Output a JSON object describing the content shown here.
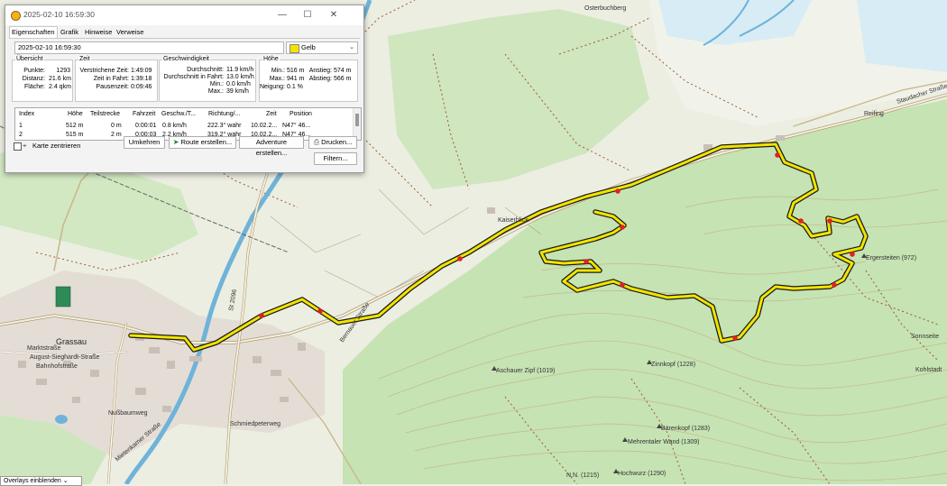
{
  "window": {
    "title": "2025-02-10 16:59:30",
    "tabs": [
      "Eigenschaften",
      "Grafik",
      "Hinweise",
      "Verweise"
    ],
    "name_value": "2025-02-10 16:59:30",
    "color_value": "Gelb",
    "colors": {
      "track": "#f2e400",
      "track_outline": "#222222"
    },
    "groups": {
      "overview": {
        "title": "Übersicht",
        "rows": [
          {
            "k": "Punkte:",
            "v": "1293"
          },
          {
            "k": "Distanz:",
            "v": "21.6 km"
          },
          {
            "k": "Fläche:",
            "v": "2.4 qkm"
          }
        ]
      },
      "time": {
        "title": "Zeit",
        "rows": [
          {
            "k": "Verstrichene Zeit:",
            "v": "1:49:09"
          },
          {
            "k": "Zeit in Fahrt:",
            "v": "1:39:18"
          },
          {
            "k": "Pausenzeit:",
            "v": "0:09:46"
          }
        ]
      },
      "speed": {
        "title": "Geschwindigkeit",
        "rows": [
          {
            "k": "Durchschnitt:",
            "v": "11.9 km/h"
          },
          {
            "k": "Durchschnitt in Fahrt:",
            "v": "13.0 km/h"
          },
          {
            "k": "Min.:",
            "v": "0.0 km/h"
          },
          {
            "k": "Max.:",
            "v": "39 km/h"
          }
        ]
      },
      "height": {
        "title": "Höhe",
        "rows": [
          {
            "k": "Min.:",
            "v": "516 m",
            "k2": "Anstieg:",
            "v2": "574 m"
          },
          {
            "k": "Max.:",
            "v": "941 m",
            "k2": "Abstieg:",
            "v2": "566 m"
          },
          {
            "k": "Neigung:",
            "v": "0.1 %"
          }
        ]
      }
    },
    "table": {
      "headers": [
        "Index",
        "Höhe",
        "Teilstrecke",
        "Fahrzeit",
        "Geschw./T...",
        "Richtung/...",
        "Zeit",
        "Position"
      ],
      "rows": [
        [
          "1",
          "512 m",
          "0 m",
          "0:00:01",
          "0.8 km/h",
          "222.3° wahr",
          "10.02.2...",
          "N47° 46..."
        ],
        [
          "2",
          "515 m",
          "2 m",
          "0:00:03",
          "2.2 km/h",
          "319.2° wahr",
          "10.02.2...",
          "N47° 46..."
        ]
      ]
    },
    "center_map_label": "Karte zentrieren",
    "buttons": {
      "reverse": "Umkehren",
      "create_route": "Route erstellen...",
      "create_adventure": "Adventure erstellen...",
      "print": "Drucken...",
      "filter": "Filtern..."
    }
  },
  "overlay": {
    "label": "Overlays einblenden"
  },
  "map_labels": {
    "grassau": "Grassau",
    "marktstrasse": "Marktstraße",
    "august_sieghardt": "August-Sieghardt-Straße",
    "bahnhofstrasse": "Bahnhofstraße",
    "nussbaumweg": "Nußbaumweg",
    "aschauer_zipf": "Aschauer Zipf (1019)",
    "zinnkopf": "Zinnkopf (1228)",
    "baerenkopf": "Bärenkopf (1283)",
    "mehrentaler": "Mehrentaler Wand (1309)",
    "hochwurz": "Hochwurz (1290)",
    "nn": "N.N. (1215)",
    "ergersteiten": "Ergersteiten (972)",
    "staudacher": "Staudacher Straße",
    "st2096": "St 2096",
    "ostenbuchberg": "Osterbuchberg",
    "kohlstadt": "Kohlstadt",
    "sonnseite": "Sonnseite",
    "reifing": "Reifing",
    "kaiserblick": "Kaiserblick",
    "schmiedpeterweg": "Schmiedpeterweg",
    "mietenkamer": "Mietenkamer Straße",
    "bernauer": "Bernauer Straße"
  }
}
